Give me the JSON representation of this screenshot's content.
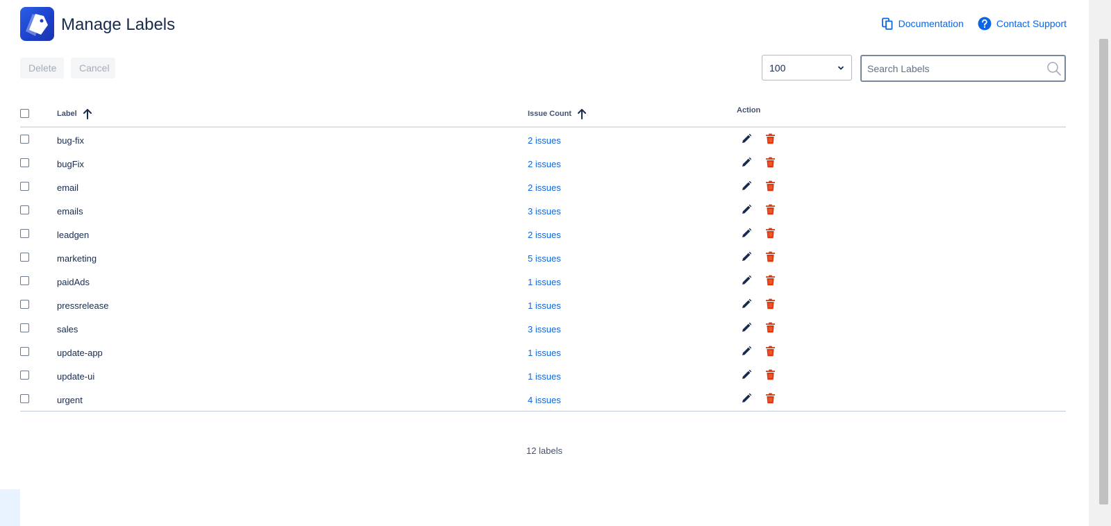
{
  "header": {
    "title": "Manage Labels",
    "links": {
      "documentation": "Documentation",
      "contact_support": "Contact Support"
    }
  },
  "toolbar": {
    "delete_label": "Delete",
    "cancel_label": "Cancel",
    "page_size": "100",
    "search_placeholder": "Search Labels"
  },
  "table": {
    "columns": {
      "label": "Label",
      "issue_count": "Issue Count",
      "action": "Action"
    },
    "rows": [
      {
        "label": "bug-fix",
        "count": "2 issues"
      },
      {
        "label": "bugFix",
        "count": "2 issues"
      },
      {
        "label": "email",
        "count": "2 issues"
      },
      {
        "label": "emails",
        "count": "3 issues"
      },
      {
        "label": "leadgen",
        "count": "2 issues"
      },
      {
        "label": "marketing",
        "count": "5 issues"
      },
      {
        "label": "paidAds",
        "count": "1 issues"
      },
      {
        "label": "pressrelease",
        "count": "1 issues"
      },
      {
        "label": "sales",
        "count": "3 issues"
      },
      {
        "label": "update-app",
        "count": "1 issues"
      },
      {
        "label": "update-ui",
        "count": "1 issues"
      },
      {
        "label": "urgent",
        "count": "4 issues"
      }
    ]
  },
  "footer": {
    "total": "12 labels"
  },
  "icons": {
    "logo": "label-tag-icon",
    "documentation": "copy-pages-icon",
    "contact_support": "question-circle-icon",
    "sort": "arrow-up-icon",
    "dropdown": "chevron-down-icon",
    "search": "search-icon",
    "edit": "pencil-icon",
    "delete": "trash-icon"
  },
  "colors": {
    "accent": "#0c66e4",
    "edit_icon": "#172b4d",
    "delete_icon": "#de350b"
  }
}
